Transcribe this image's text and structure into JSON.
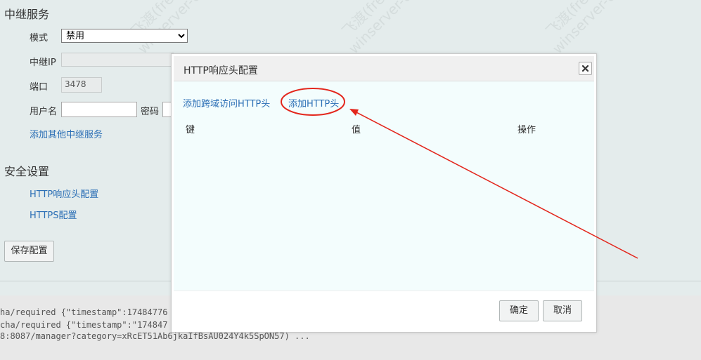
{
  "relay": {
    "section_title": "中继服务",
    "mode_label": "模式",
    "mode_value": "禁用",
    "ip_label": "中继IP",
    "port_label": "端口",
    "port_value": "3478",
    "username_label": "用户名",
    "password_label": "密码",
    "add_other_link": "添加其他中继服务"
  },
  "security": {
    "section_title": "安全设置",
    "http_headers_link": "HTTP响应头配置",
    "https_link": "HTTPS配置"
  },
  "save_button": "保存配置",
  "log_lines": [
    "ha/required {\"timestamp\":17484776",
    "cha/required {\"timestamp\":\"174847",
    "8:8087/manager?category=xRcET51Ab6jkaIfBsAU024Y4k5SpON57) ..."
  ],
  "watermark": {
    "line1": "飞渡(freedo)",
    "line2": "winserver-002"
  },
  "dialog": {
    "title": "HTTP响应头配置",
    "add_cors_link": "添加跨域访问HTTP头",
    "add_header_link": "添加HTTP头",
    "columns": [
      "键",
      "值",
      "操作"
    ],
    "confirm_button": "确定",
    "cancel_button": "取消"
  },
  "colors": {
    "link": "#2a6eb5",
    "annotation": "#e3261c",
    "dialog_body": "#f3fdfd",
    "background": "#e4ecec"
  }
}
